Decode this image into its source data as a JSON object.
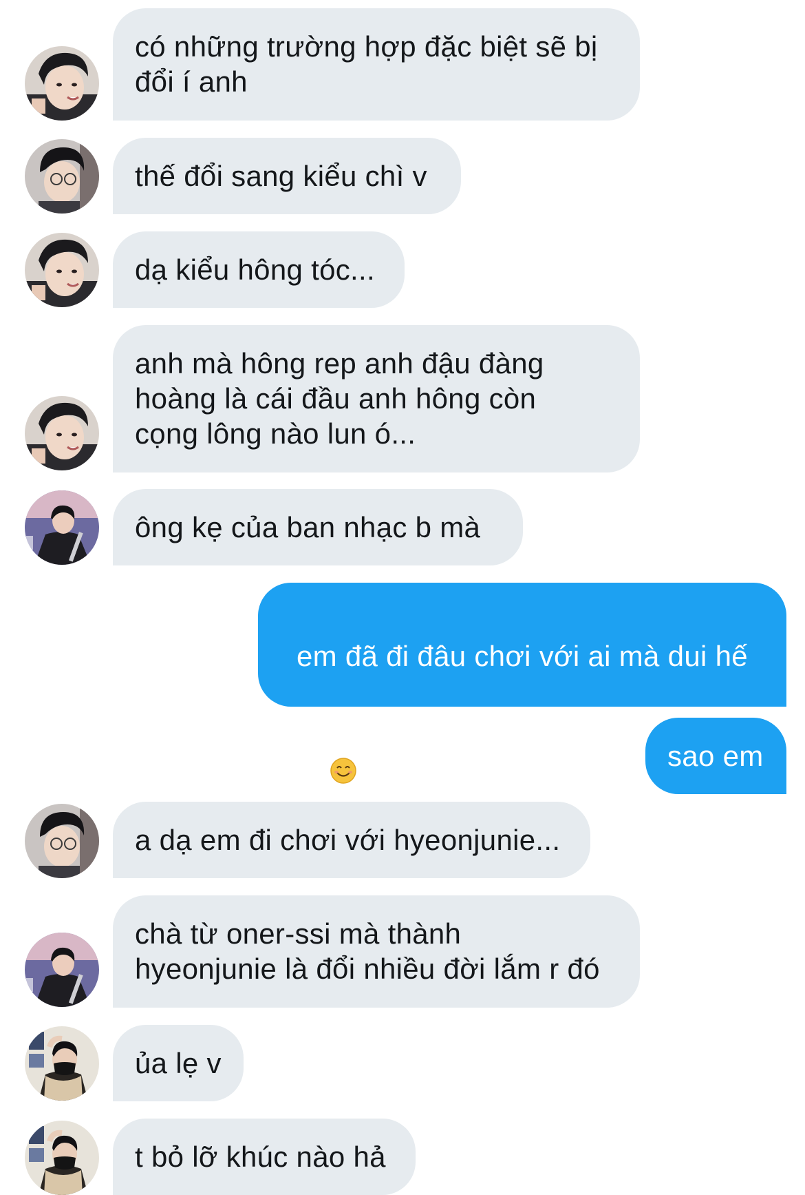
{
  "conversation": {
    "messages": [
      {
        "text": "có những trường hợp đặc biệt sẽ bị\nđổi í anh"
      },
      {
        "text": "thế đổi sang kiểu chì v"
      },
      {
        "text": "dạ kiểu hông tóc..."
      },
      {
        "text": "anh mà hông rep anh đậu đàng\nhoàng là cái đầu anh hông còn\ncọng lông nào lun ó..."
      },
      {
        "text": "ông kẹ của ban nhạc b mà"
      },
      {
        "text": "em đã đi đâu chơi với ai mà dui hế"
      },
      {
        "text": "sao em"
      },
      {
        "text": "a dạ em đi chơi với hyeonjunie..."
      },
      {
        "text": "chà từ oner-ssi mà thành\nhyeonjunie là đổi nhiều đời lắm r đó"
      },
      {
        "text": "ủa lẹ v"
      },
      {
        "text": "t bỏ lỡ khúc nào hả"
      }
    ],
    "emoji_icon": "smiling-face-emoji"
  },
  "colors": {
    "incoming_bubble": "#e6ebef",
    "outgoing_bubble": "#1da1f2",
    "incoming_text": "#14171a",
    "outgoing_text": "#ffffff"
  }
}
